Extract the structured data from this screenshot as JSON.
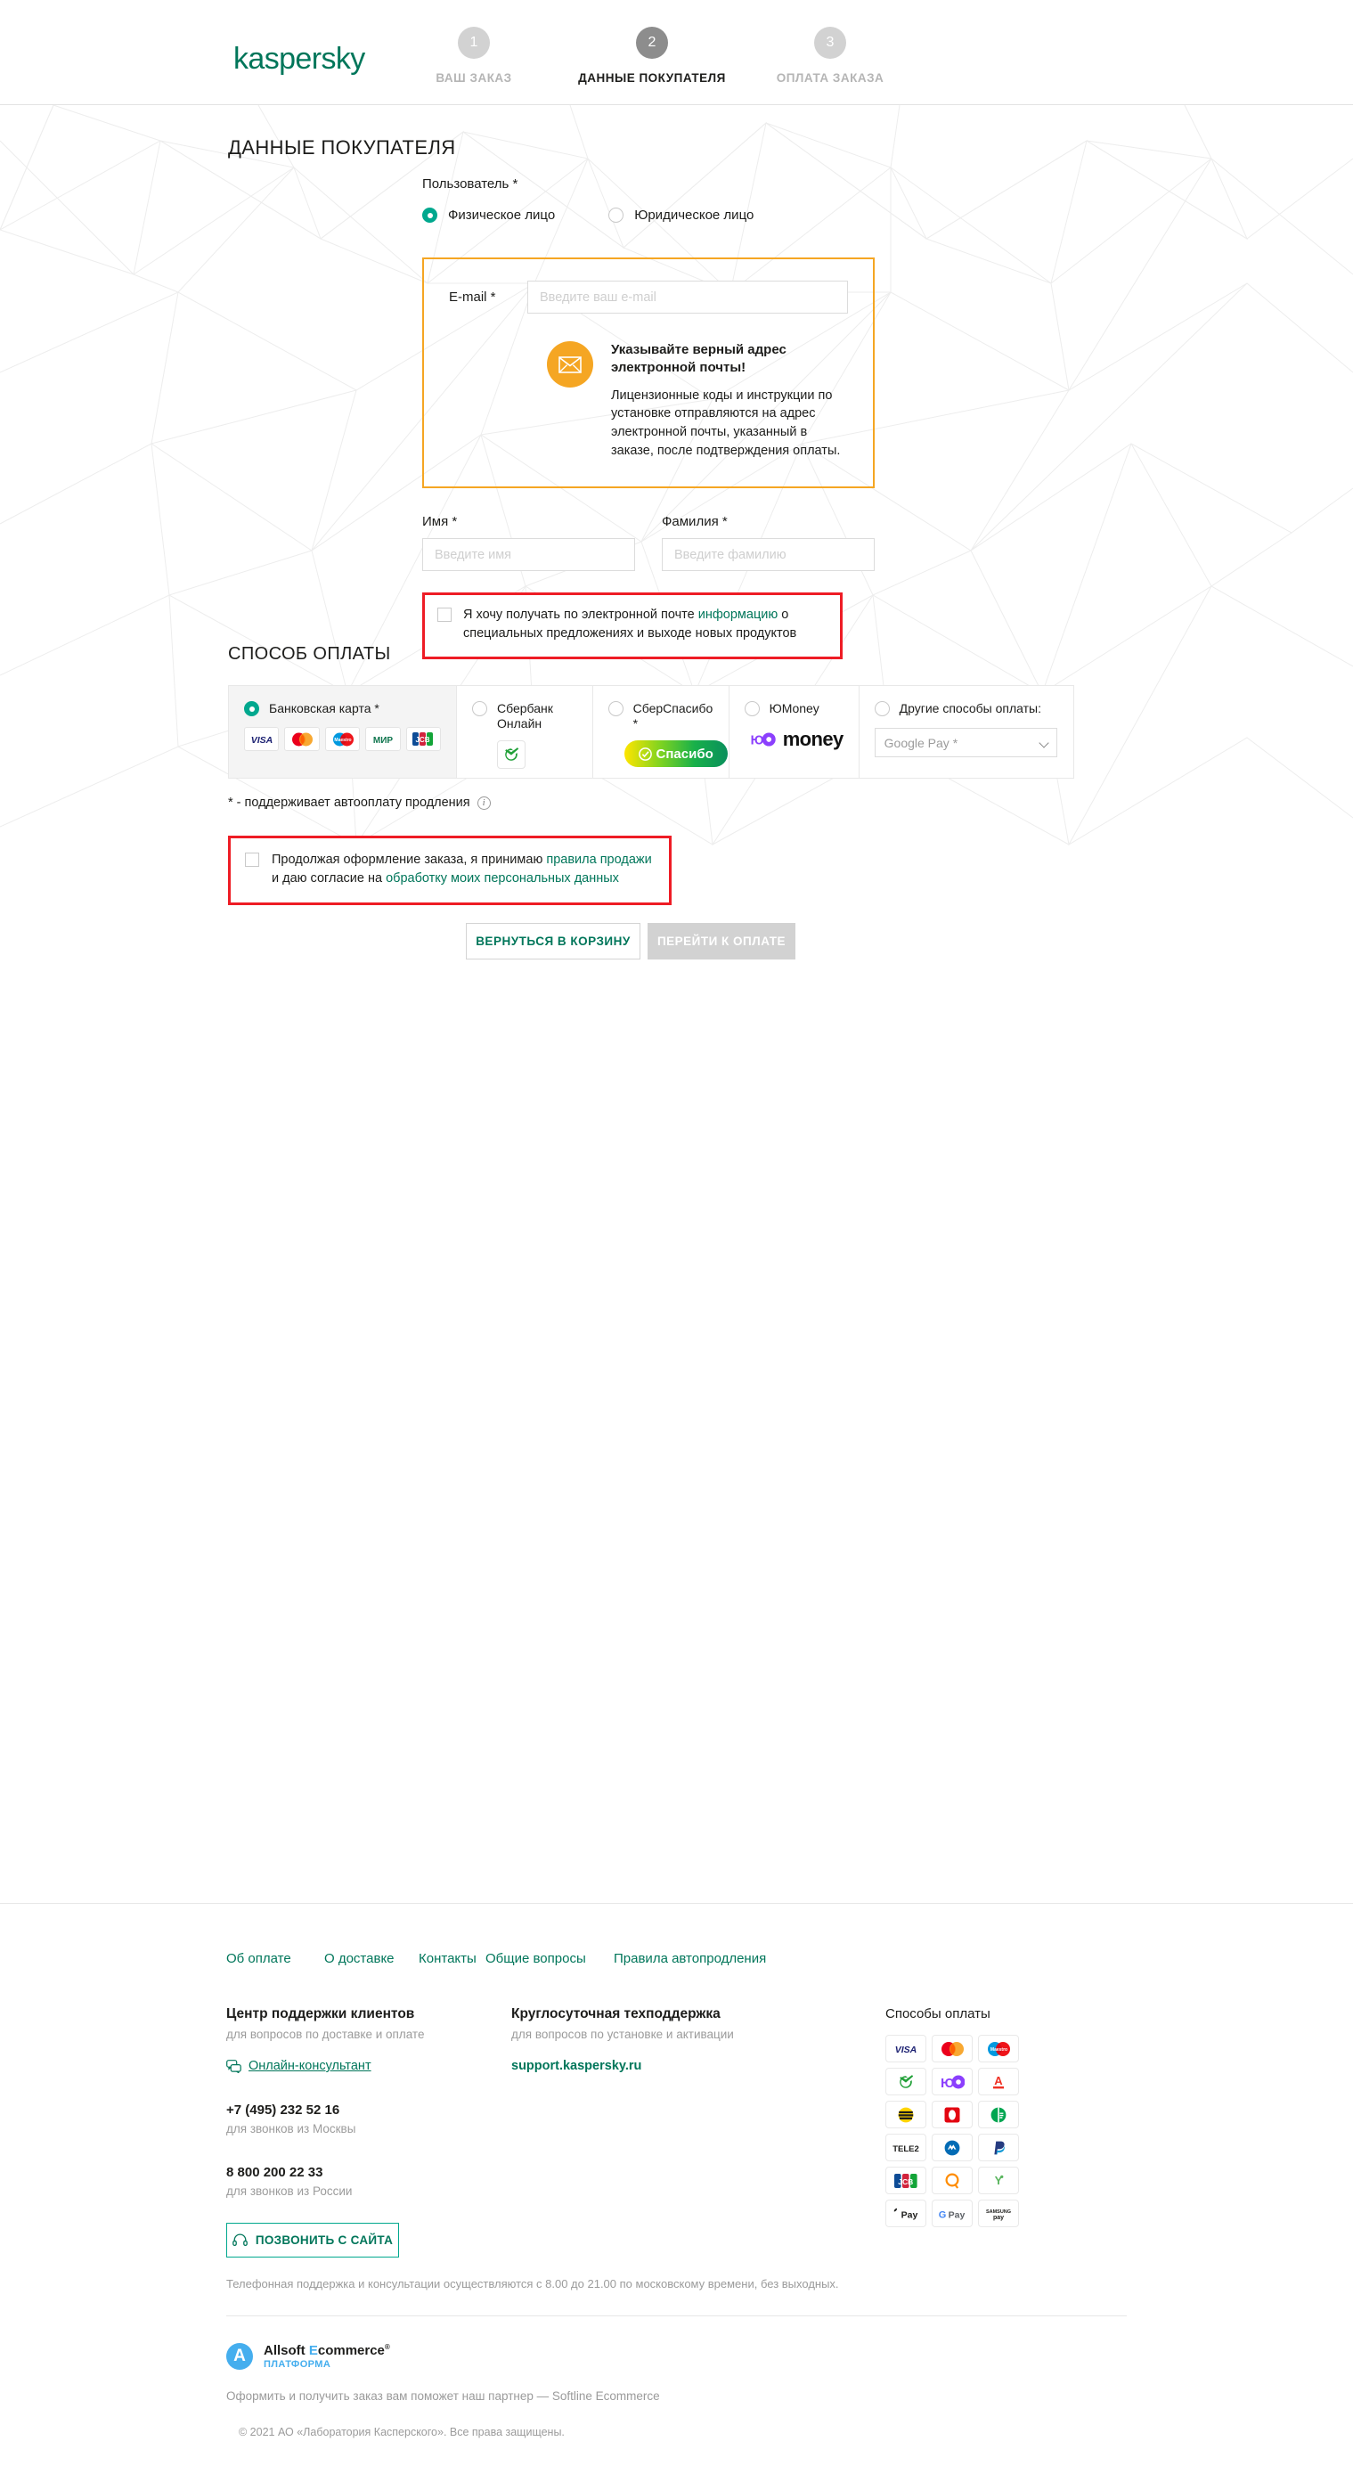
{
  "header": {
    "logo": "kaspersky",
    "steps": [
      {
        "num": "1",
        "label": "ВАШ ЗАКАЗ",
        "active": false
      },
      {
        "num": "2",
        "label": "ДАННЫЕ ПОКУПАТЕЛЯ",
        "active": true
      },
      {
        "num": "3",
        "label": "ОПЛАТА ЗАКАЗА",
        "active": false
      }
    ]
  },
  "main": {
    "page_title": "ДАННЫЕ ПОКУПАТЕЛЯ",
    "user_type_label": "Пользователь *",
    "user_type_options": [
      {
        "label": "Физическое лицо",
        "selected": true
      },
      {
        "label": "Юридическое лицо",
        "selected": false
      }
    ],
    "email": {
      "label": "E-mail *",
      "value": "",
      "placeholder": "Введите ваш e-mail",
      "warning_title": "Указывайте верный адрес электронной почты!",
      "warning_text": "Лицензионные коды и инструкции по установке отправляются на адрес электронной почты, указанный в заказе, после подтверждения оплаты.",
      "warning_icon": "envelope-icon",
      "border_color": "#f5a623"
    },
    "first_name": {
      "label": "Имя *",
      "value": "",
      "placeholder": "Введите имя"
    },
    "last_name": {
      "label": "Фамилия *",
      "value": "",
      "placeholder": "Введите фамилию"
    },
    "promo_consent": {
      "checked": false,
      "text_before": "Я хочу получать по электронной почте ",
      "link": "информацию",
      "text_after": " о специальных предложениях и выходе новых продуктов",
      "highlight_color": "#ee1c25"
    }
  },
  "payment": {
    "title": "СПОСОБ ОПЛАТЫ",
    "methods": [
      {
        "label": "Банковская карта *",
        "selected": true,
        "cards": [
          "VISA",
          "Mastercard",
          "Maestro",
          "МИР",
          "JCB"
        ]
      },
      {
        "label": "Сбербанк Онлайн",
        "selected": false,
        "logo": "sberbank-icon"
      },
      {
        "label": "СберСпасибо *",
        "selected": false,
        "logo": "spasibo-badge",
        "badge_text": "Спасибо"
      },
      {
        "label": "ЮMoney",
        "selected": false,
        "logo": "yoomoney-logo",
        "logo_text": "money"
      },
      {
        "label": "Другие способы оплаты:",
        "selected": false,
        "select_value": "Google Pay *"
      }
    ],
    "autopay_note": "* - поддерживает автооплату продления",
    "autopay_info_icon": "info-icon",
    "terms": {
      "checked": false,
      "text_1": "Продолжая оформление заказа, я принимаю ",
      "link_1": "правила продажи",
      "text_2": " и даю согласие на ",
      "link_2": "обработку моих персональных данных",
      "highlight_color": "#ee1c25"
    },
    "back_button": "ВЕРНУТЬСЯ В КОРЗИНУ",
    "pay_button": "ПЕРЕЙТИ К ОПЛАТЕ"
  },
  "footer": {
    "nav": [
      "Об оплате",
      "О доставке",
      "Контакты",
      "Общие вопросы",
      "Правила автопродления"
    ],
    "support": {
      "title": "Центр поддержки клиентов",
      "subtitle": "для вопросов по доставке и оплате",
      "consultant": "Онлайн-консультант",
      "consultant_icon": "chat-icon",
      "phone_moscow": "+7 (495) 232 52 16",
      "phone_moscow_note": "для звонков из Москвы",
      "phone_russia": "8 800 200 22 33",
      "phone_russia_note": "для звонков из России",
      "call_button": "ПОЗВОНИТЬ С САЙТА",
      "call_button_icon": "headset-icon",
      "hours": "Телефонная поддержка и консультации осуществляются с 8.00 до 21.00 по московскому времени, без выходных."
    },
    "tech": {
      "title": "Круглосуточная техподдержка",
      "subtitle": "для вопросов по установке и активации",
      "link": "support.kaspersky.ru"
    },
    "pay_methods": {
      "title": "Способы оплаты",
      "icons": [
        "VISA",
        "Mastercard",
        "Maestro",
        "Сбербанк",
        "ЮMoney",
        "Альфа-Банк",
        "Билайн",
        "МТС",
        "Мегафон",
        "Tele2",
        "WebMoney",
        "PayPal",
        "JCB",
        "QIWI",
        "Яндекс",
        "Apple Pay",
        "Google Pay",
        "Samsung Pay"
      ]
    },
    "allsoft": {
      "badge": "A",
      "name_1": "Allsoft ",
      "name_e": "E",
      "name_2": "commerce",
      "reg": "®",
      "sub": "ПЛАТФОРМА"
    },
    "partner_note": "Оформить и получить заказ вам поможет наш партнер — Softline Ecommerce",
    "copyright": "© 2021 АО «Лаборатория Касперского». Все права защищены."
  }
}
